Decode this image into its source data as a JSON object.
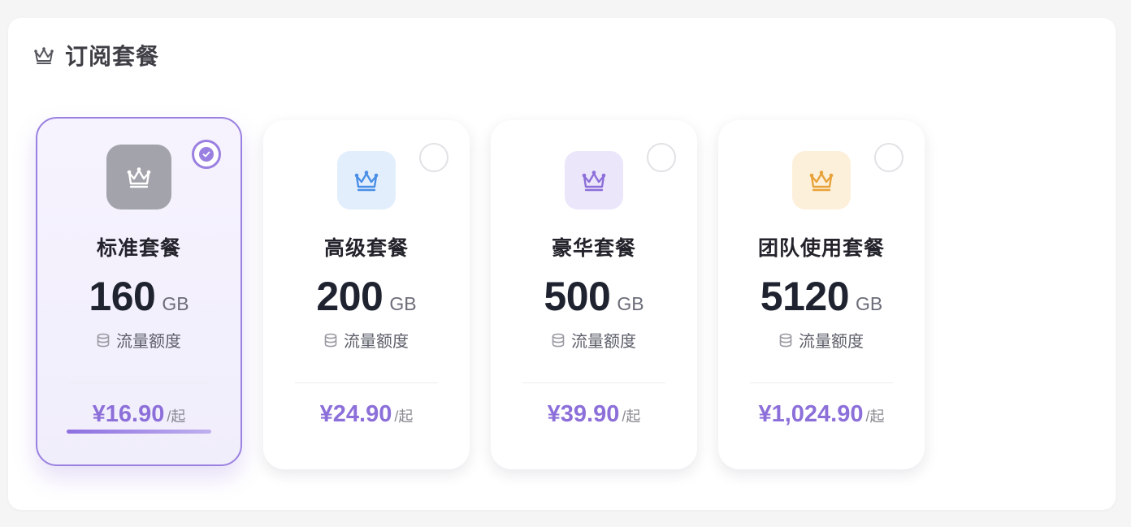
{
  "section": {
    "title": "订阅套餐",
    "icon": "crown-icon"
  },
  "plans": [
    {
      "id": "standard",
      "name": "标准套餐",
      "size": "160",
      "unit": "GB",
      "quota_label": "流量额度",
      "price": "¥16.90",
      "per": "/起",
      "selected": true,
      "icon_color": "#ffffff",
      "icon_bg": "#a3a4ab"
    },
    {
      "id": "advanced",
      "name": "高级套餐",
      "size": "200",
      "unit": "GB",
      "quota_label": "流量额度",
      "price": "¥24.90",
      "per": "/起",
      "selected": false,
      "icon_color": "#4a8fe7",
      "icon_bg": "#e3eefc"
    },
    {
      "id": "deluxe",
      "name": "豪华套餐",
      "size": "500",
      "unit": "GB",
      "quota_label": "流量额度",
      "price": "¥39.90",
      "per": "/起",
      "selected": false,
      "icon_color": "#8c6fd9",
      "icon_bg": "#ece6fb"
    },
    {
      "id": "team",
      "name": "团队使用套餐",
      "size": "5120",
      "unit": "GB",
      "quota_label": "流量额度",
      "price": "¥1,024.90",
      "per": "/起",
      "selected": false,
      "icon_color": "#e8a23a",
      "icon_bg": "#fdf0da"
    }
  ],
  "colors": {
    "accent": "#8c6fd9",
    "accent_border": "#9a80e0"
  }
}
